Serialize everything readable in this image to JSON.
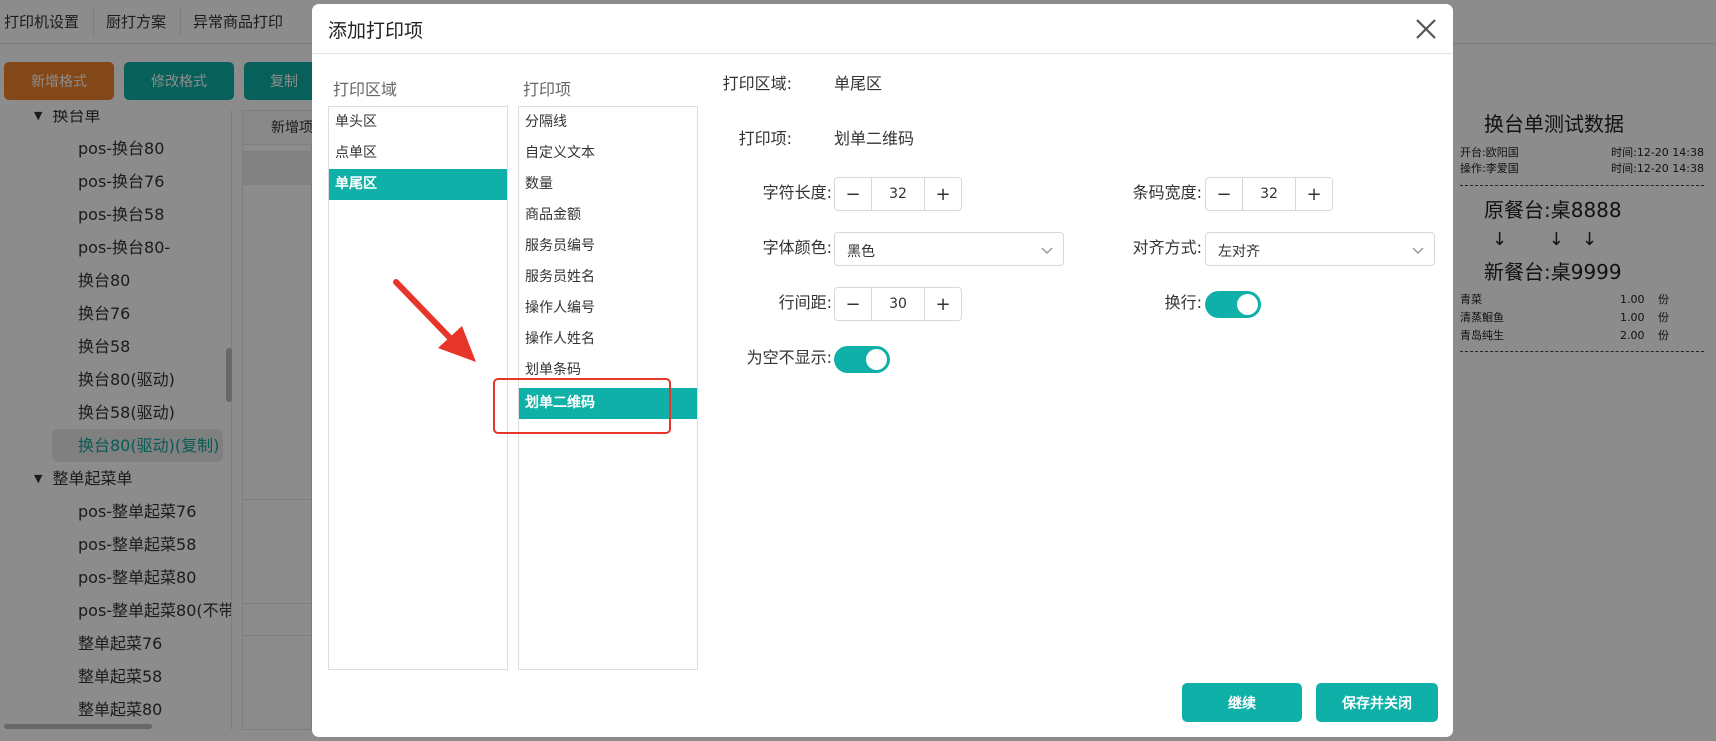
{
  "background": {
    "topnav_tabs": [
      "打印机设置",
      "厨打方案",
      "异常商品打印"
    ],
    "buttons": {
      "add_format": "新增格式",
      "edit_format": "修改格式",
      "copy": "复制"
    },
    "tree": {
      "partial_group": "换台单",
      "items_group1": [
        "pos-换台80",
        "pos-换台76",
        "pos-换台58",
        "pos-换台80-",
        "换台80",
        "换台76",
        "换台58",
        "换台80(驱动)",
        "换台58(驱动)"
      ],
      "selected_item": "换台80(驱动)(复制)",
      "group2": "整单起菜单",
      "items_group2": [
        "pos-整单起菜76",
        "pos-整单起菜58",
        "pos-整单起菜80",
        "pos-整单起菜80(不带",
        "整单起菜76",
        "整单起菜58",
        "整单起菜80"
      ]
    },
    "mid_add_label": "新增项",
    "receipt": {
      "title": "换台单测试数据",
      "opener": "开台:欧阳国",
      "open_time": "时间:12-20 14:38",
      "operator": "操作:李爱国",
      "op_time": "时间:12-20 14:38",
      "original_table": "原餐台:桌8888",
      "arrows": "↓ ↓↓",
      "new_table": "新餐台:桌9999",
      "items": [
        {
          "name": "青菜",
          "qty": "1.00",
          "unit": "份"
        },
        {
          "name": "清蒸鮰鱼",
          "qty": "1.00",
          "unit": "份"
        },
        {
          "name": "青岛纯生",
          "qty": "2.00",
          "unit": "份"
        }
      ]
    }
  },
  "modal": {
    "title": "添加打印项",
    "area_column_label": "打印区域",
    "item_column_label": "打印项",
    "areas": [
      "单头区",
      "点单区",
      "单尾区"
    ],
    "items": [
      "分隔线",
      "自定义文本",
      "数量",
      "商品金额",
      "服务员编号",
      "服务员姓名",
      "操作人编号",
      "操作人姓名",
      "划单条码",
      "划单二维码"
    ],
    "form": {
      "area_label": "打印区域:",
      "area_value": "单尾区",
      "item_label": "打印项:",
      "item_value": "划单二维码",
      "char_length_label": "字符长度:",
      "char_length": "32",
      "barcode_width_label": "条码宽度:",
      "barcode_width": "32",
      "font_color_label": "字体颜色:",
      "font_color": "黑色",
      "align_label": "对齐方式:",
      "align": "左对齐",
      "line_spacing_label": "行间距:",
      "line_spacing": "30",
      "wrap_label": "换行:",
      "hide_empty_label": "为空不显示:",
      "minus": "−",
      "plus": "+"
    },
    "continue_button": "继续",
    "save_close_button": "保存并关闭"
  },
  "colors": {
    "accent": "#0fb0a7",
    "orange": "#f0812a",
    "annotation": "#e8352a"
  }
}
